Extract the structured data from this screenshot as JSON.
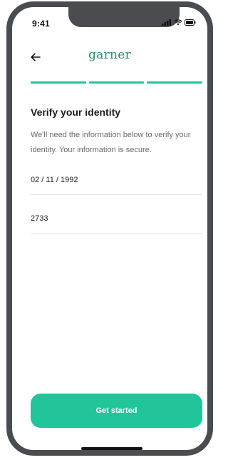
{
  "status_bar": {
    "time": "9:41",
    "icons": [
      "signal-icon",
      "wifi-icon",
      "battery-icon"
    ]
  },
  "header": {
    "back_icon": "arrow-left-icon",
    "brand": "garner"
  },
  "progress": {
    "steps_total": 3,
    "steps_complete": 3,
    "color": "#24c49a"
  },
  "content": {
    "title": "Verify your identity",
    "description": "We'll need the information below to verify your identity. Your information is secure.",
    "dob_value": "02 / 11 / 1992",
    "ssn_value": "2733"
  },
  "cta": {
    "label": "Get started",
    "color": "#22c49a"
  },
  "colors": {
    "brand": "#2a8a6a",
    "accent": "#24c49a",
    "text": "#1b1b1b",
    "muted": "#6a6a6a"
  }
}
